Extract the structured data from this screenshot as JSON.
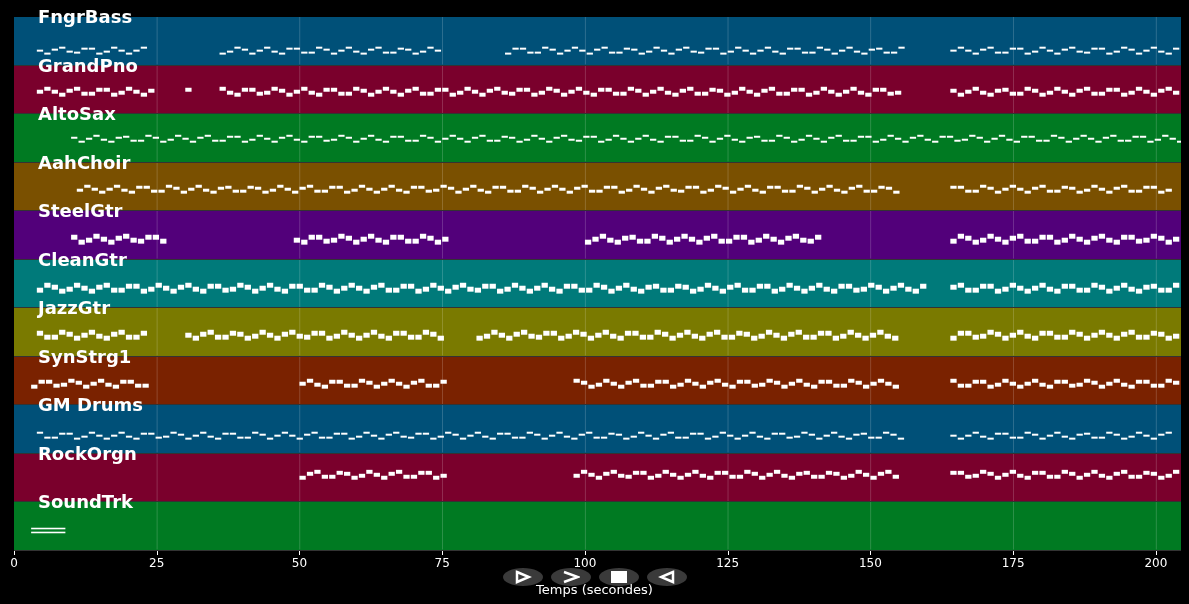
{
  "tracks": [
    {
      "name": "FngrBass",
      "color": "#005078"
    },
    {
      "name": "GrandPno",
      "color": "#7a002c"
    },
    {
      "name": "AltoSax",
      "color": "#007a22"
    },
    {
      "name": "AahChoir",
      "color": "#7a5000"
    },
    {
      "name": "SteelGtr",
      "color": "#52007a"
    },
    {
      "name": "CleanGtr",
      "color": "#007a7a"
    },
    {
      "name": "JazzGtr",
      "color": "#7a7a00"
    },
    {
      "name": "SynStrg1",
      "color": "#7a2200"
    },
    {
      "name": "GM Drums",
      "color": "#005078"
    },
    {
      "name": "RockOrgn",
      "color": "#7a002c"
    },
    {
      "name": "SoundTrk",
      "color": "#007a22"
    }
  ],
  "axis": {
    "ticks": [
      "0",
      "25",
      "50",
      "75",
      "100",
      "125",
      "150",
      "175",
      "200"
    ],
    "label": "Temps (secondes)"
  },
  "controls": [
    {
      "kind": "play"
    },
    {
      "kind": "forward"
    },
    {
      "kind": "stop"
    },
    {
      "kind": "back"
    }
  ]
}
